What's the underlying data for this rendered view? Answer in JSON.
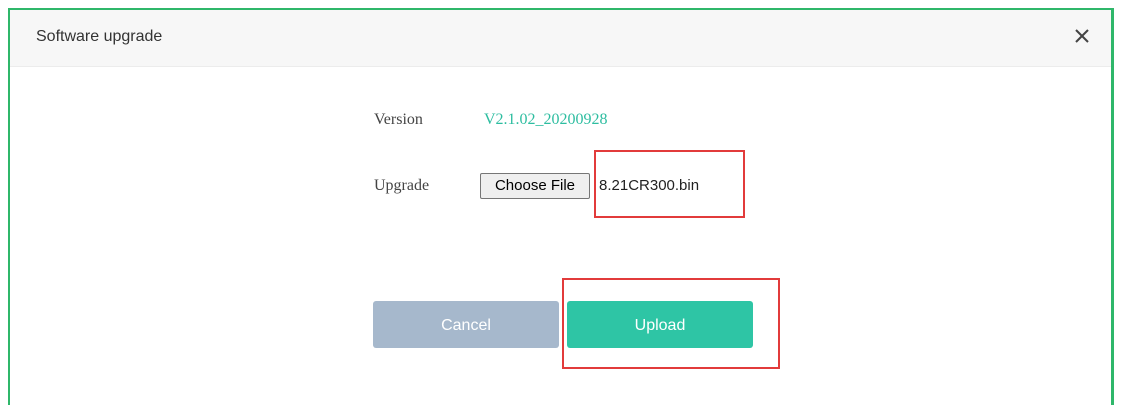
{
  "dialog": {
    "title": "Software upgrade",
    "close_icon": "close-icon"
  },
  "form": {
    "version_label": "Version",
    "version_value": "V2.1.02_20200928",
    "upgrade_label": "Upgrade",
    "choose_file_label": "Choose File",
    "file_name": "8.21CR300.bin"
  },
  "actions": {
    "cancel_label": "Cancel",
    "upload_label": "Upload"
  },
  "colors": {
    "accent": "#2ec5a5",
    "version_text": "#2dbda0",
    "cancel_button": "#a6b8cc",
    "highlight": "#e23b3b",
    "frame_border": "#2fb76a"
  }
}
